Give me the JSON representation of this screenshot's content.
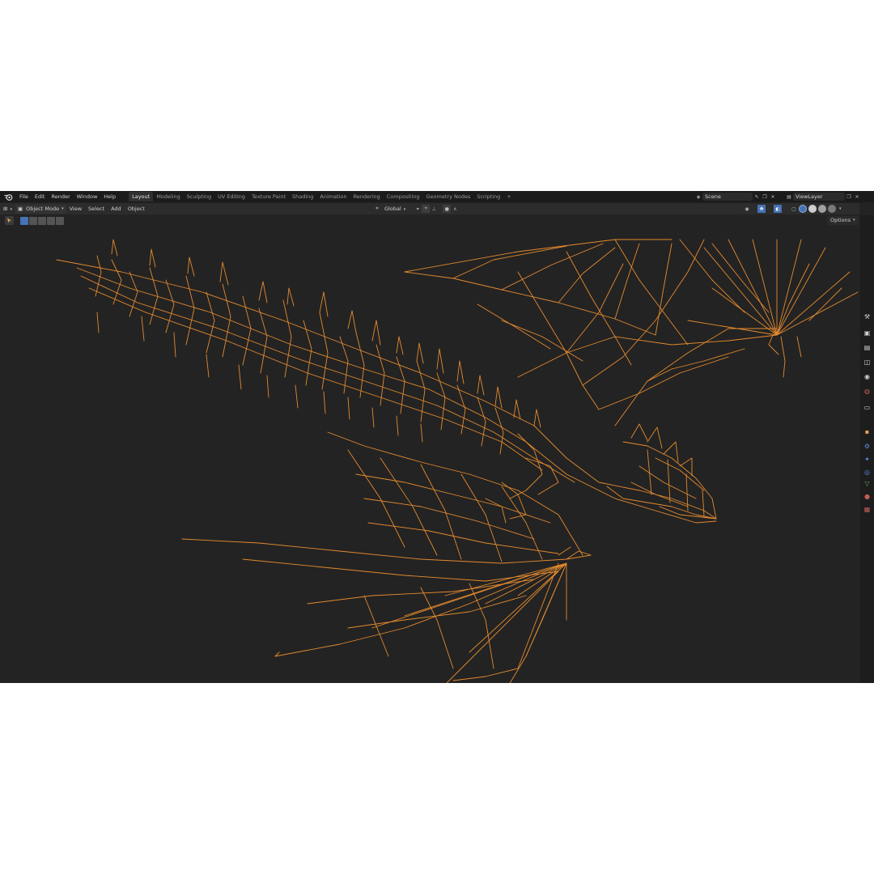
{
  "top_menu": {
    "items": [
      "File",
      "Edit",
      "Render",
      "Window",
      "Help"
    ]
  },
  "workspace_tabs": {
    "items": [
      "Layout",
      "Modeling",
      "Sculpting",
      "UV Editing",
      "Texture Paint",
      "Shading",
      "Animation",
      "Rendering",
      "Compositing",
      "Geometry Nodes",
      "Scripting"
    ],
    "active": "Layout",
    "add_label": "+"
  },
  "scene": {
    "name": "Scene"
  },
  "view_layer": {
    "name": "ViewLayer"
  },
  "header": {
    "mode": "Object Mode",
    "menus": [
      "View",
      "Select",
      "Add",
      "Object"
    ],
    "transform_orientation": "Global",
    "options_label": "Options"
  },
  "icons": {
    "logo": "blender-logo-icon",
    "editor_type": "3d-viewport-icon",
    "mode": "object-mode-icon",
    "pivot": "transform-orientation-icon",
    "snap": "snap-icon",
    "proportional": "proportional-editing-icon",
    "shading": [
      "wireframe-shading-icon",
      "solid-shading-icon",
      "material-shading-icon",
      "rendered-shading-icon"
    ]
  },
  "colors": {
    "wire": "#e58a2e",
    "background": "#232323",
    "accent": "#4772b3"
  },
  "properties_tabs": [
    "tool-icon",
    "render-icon",
    "output-icon",
    "view-layer-icon",
    "scene-icon",
    "world-icon",
    "collection-icon",
    "modifier-icon",
    "particles-icon",
    "physics-icon",
    "constraints-icon",
    "data-icon",
    "material-icon",
    "texture-icon"
  ]
}
